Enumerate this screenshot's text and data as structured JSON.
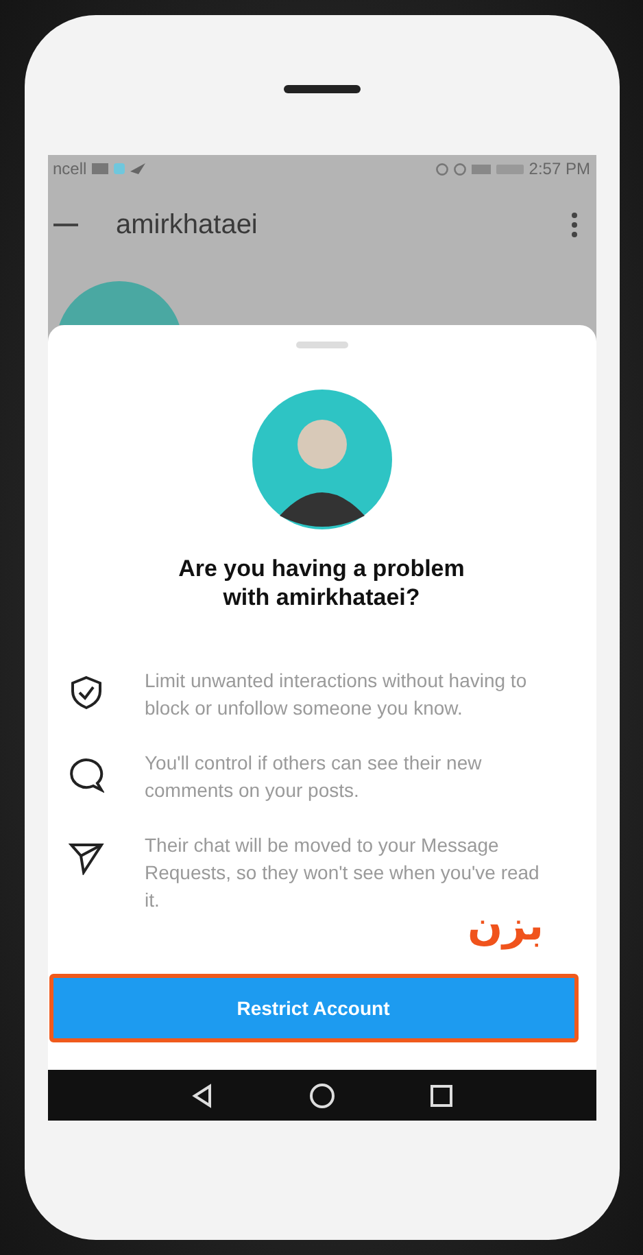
{
  "status_bar": {
    "carrier": "ncell",
    "time": "2:57 PM"
  },
  "profile": {
    "username": "amirkhataei"
  },
  "sheet": {
    "title": "Are you having a problem with amirkhataei?",
    "items": [
      {
        "kind": "shield",
        "text": "Limit unwanted interactions without having to block or unfollow someone you know."
      },
      {
        "kind": "comment",
        "text": "You'll control if others can see their new comments on your posts."
      },
      {
        "kind": "send",
        "text": "Their chat will be moved to your Message Requests, so they won't see when you've read it."
      }
    ],
    "button": "Restrict Account"
  },
  "annotation": {
    "text": "بزن"
  }
}
